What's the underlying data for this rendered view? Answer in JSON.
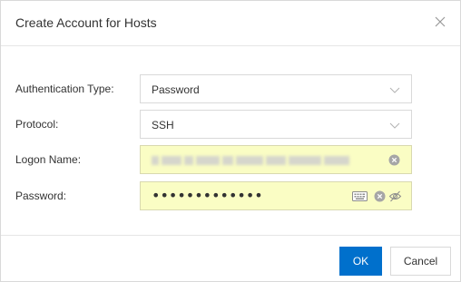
{
  "dialog": {
    "title": "Create Account for Hosts",
    "close_icon": "close-icon"
  },
  "form": {
    "auth_type": {
      "label": "Authentication Type",
      "value": "Password"
    },
    "protocol": {
      "label": "Protocol",
      "value": "SSH"
    },
    "logon_name": {
      "label": "Logon Name"
    },
    "password": {
      "label": "Password",
      "value": "•••••••••••••"
    },
    "label_suffix": ":"
  },
  "footer": {
    "ok_label": "OK",
    "cancel_label": "Cancel"
  },
  "colors": {
    "primary": "#0070cc",
    "autofill_bg": "#fafdc4",
    "border": "#d9d9d9"
  }
}
